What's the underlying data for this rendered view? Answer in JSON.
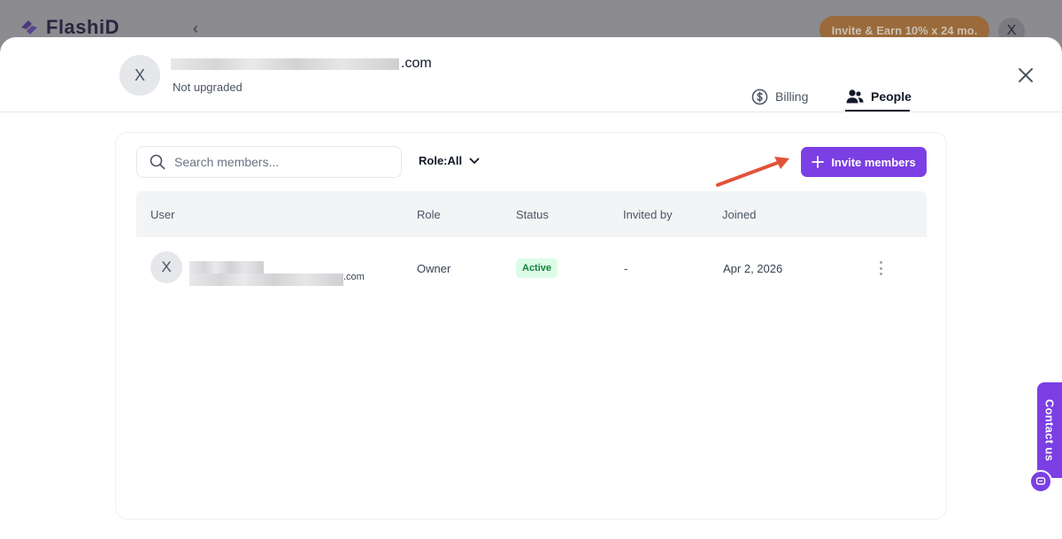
{
  "background": {
    "logo_text": "FlashiD",
    "back_glyph": "‹",
    "invite_earn_label": "Invite & Earn 10% x 24 mo.",
    "avatar_initial": "X"
  },
  "account": {
    "avatar_initial": "X",
    "email_suffix": ".com",
    "status": "Not upgraded"
  },
  "tabs": [
    {
      "label": "Billing",
      "icon": "dollar-circle-icon",
      "active": false
    },
    {
      "label": "People",
      "icon": "people-icon",
      "active": true
    }
  ],
  "toolbar": {
    "search_placeholder": "Search members...",
    "role_filter_label": "Role:All",
    "invite_button_label": "Invite members"
  },
  "table": {
    "columns": [
      "User",
      "Role",
      "Status",
      "Invited by",
      "Joined"
    ],
    "rows": [
      {
        "avatar_initial": "X",
        "email_suffix": ".com",
        "role": "Owner",
        "status": "Active",
        "invited_by": "-",
        "joined": "Apr 2, 2026"
      }
    ]
  },
  "contact": {
    "label": "Contact us"
  },
  "colors": {
    "accent": "#7b3fe4",
    "annotation_arrow": "#e0533a",
    "status_active_bg": "#dcfce7",
    "status_active_text": "#15803d"
  }
}
